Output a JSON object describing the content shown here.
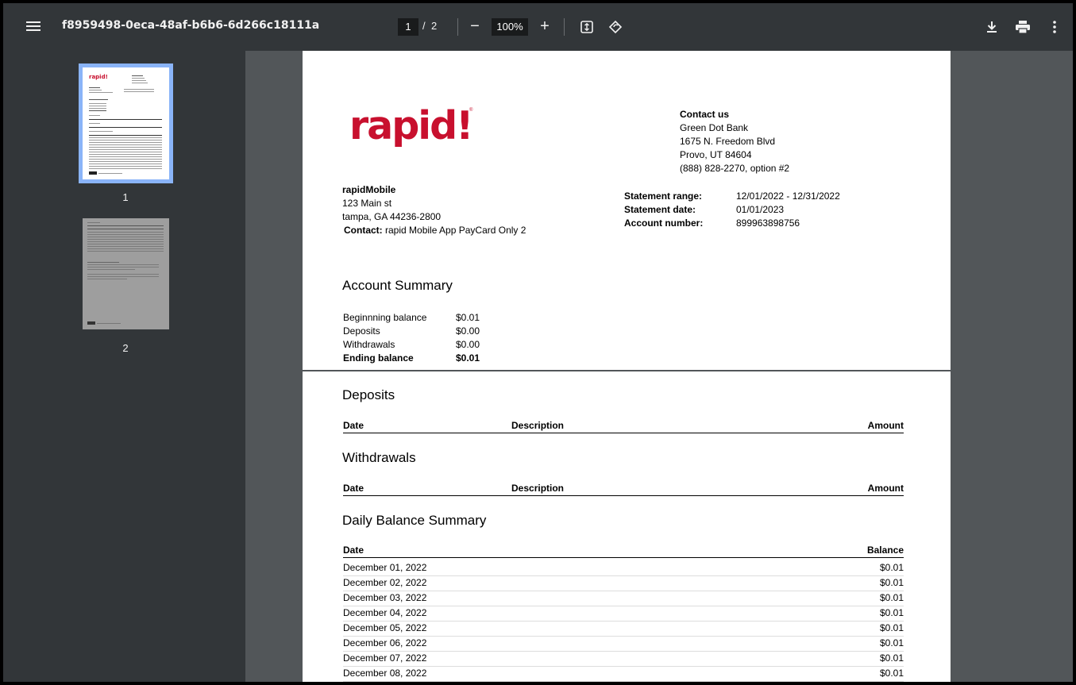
{
  "toolbar": {
    "title": "f8959498-0eca-48af-b6b6-6d266c18111a",
    "current_page": "1",
    "page_sep": "/",
    "total_pages": "2",
    "zoom": "100%",
    "zoom_out": "−",
    "zoom_in": "+"
  },
  "sidebar": {
    "thumbnails": [
      {
        "label": "1"
      },
      {
        "label": "2"
      }
    ]
  },
  "statement": {
    "logo": "rapid!",
    "logo_mark": "®",
    "contact": {
      "heading": "Contact us",
      "line1": "Green Dot Bank",
      "line2": "1675 N. Freedom Blvd",
      "line3": "Provo, UT 84604",
      "line4": "(888) 828-2270, option #2"
    },
    "customer": {
      "name": "rapidMobile",
      "street": "123 Main st",
      "city": "tampa, GA  44236-2800",
      "contact_label": "Contact:",
      "contact_value": "rapid Mobile App PayCard Only 2"
    },
    "info": [
      {
        "label": "Statement range:",
        "value": "12/01/2022 - 12/31/2022"
      },
      {
        "label": "Statement date:",
        "value": "01/01/2023"
      },
      {
        "label": "Account number:",
        "value": "899963898756"
      }
    ],
    "account_summary": {
      "title": "Account Summary",
      "rows": [
        {
          "label": "Beginnning balance",
          "value": "$0.01"
        },
        {
          "label": "Deposits",
          "value": "$0.00"
        },
        {
          "label": "Withdrawals",
          "value": "$0.00"
        },
        {
          "label": "Ending balance",
          "value": "$0.01"
        }
      ]
    },
    "deposits": {
      "title": "Deposits",
      "col_date": "Date",
      "col_desc": "Description",
      "col_amount": "Amount"
    },
    "withdrawals": {
      "title": "Withdrawals",
      "col_date": "Date",
      "col_desc": "Description",
      "col_amount": "Amount"
    },
    "daily_balance": {
      "title": "Daily Balance Summary",
      "col_date": "Date",
      "col_balance": "Balance",
      "rows": [
        {
          "date": "December 01, 2022",
          "balance": "$0.01"
        },
        {
          "date": "December 02, 2022",
          "balance": "$0.01"
        },
        {
          "date": "December 03, 2022",
          "balance": "$0.01"
        },
        {
          "date": "December 04, 2022",
          "balance": "$0.01"
        },
        {
          "date": "December 05, 2022",
          "balance": "$0.01"
        },
        {
          "date": "December 06, 2022",
          "balance": "$0.01"
        },
        {
          "date": "December 07, 2022",
          "balance": "$0.01"
        },
        {
          "date": "December 08, 2022",
          "balance": "$0.01"
        }
      ]
    }
  }
}
